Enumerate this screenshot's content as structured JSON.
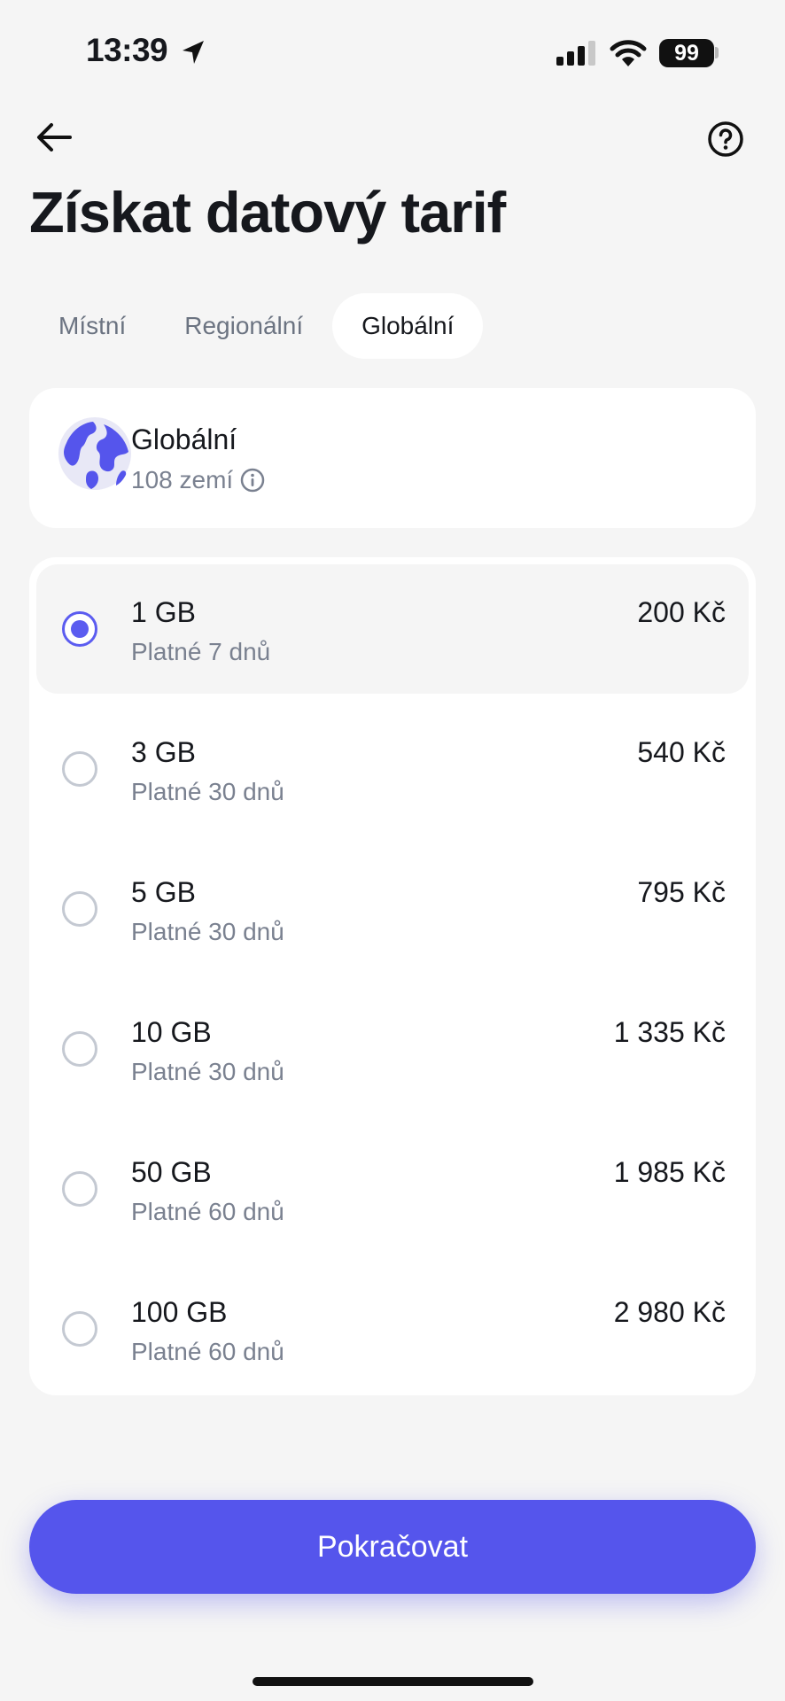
{
  "status_bar": {
    "time": "13:39",
    "battery": "99"
  },
  "header": {
    "title": "Získat datový tarif"
  },
  "tabs": [
    {
      "label": "Místní",
      "active": false
    },
    {
      "label": "Regionální",
      "active": false
    },
    {
      "label": "Globální",
      "active": true
    }
  ],
  "region": {
    "name": "Globální",
    "countries": "108 zemí"
  },
  "plans": [
    {
      "size": "1 GB",
      "validity": "Platné 7 dnů",
      "price": "200 Kč",
      "selected": true
    },
    {
      "size": "3 GB",
      "validity": "Platné 30 dnů",
      "price": "540 Kč",
      "selected": false
    },
    {
      "size": "5 GB",
      "validity": "Platné 30 dnů",
      "price": "795 Kč",
      "selected": false
    },
    {
      "size": "10 GB",
      "validity": "Platné 30 dnů",
      "price": "1 335 Kč",
      "selected": false
    },
    {
      "size": "50 GB",
      "validity": "Platné 60 dnů",
      "price": "1 985 Kč",
      "selected": false
    },
    {
      "size": "100 GB",
      "validity": "Platné 60 dnů",
      "price": "2 980 Kč",
      "selected": false
    }
  ],
  "footer": {
    "continue_label": "Pokračovat"
  },
  "colors": {
    "accent": "#5555ec",
    "background": "#f5f5f5",
    "card": "#ffffff"
  },
  "icons": [
    "location-arrow-icon",
    "cellular-signal-icon",
    "wifi-icon",
    "battery-icon",
    "back-arrow-icon",
    "help-icon",
    "globe-icon",
    "info-icon"
  ]
}
